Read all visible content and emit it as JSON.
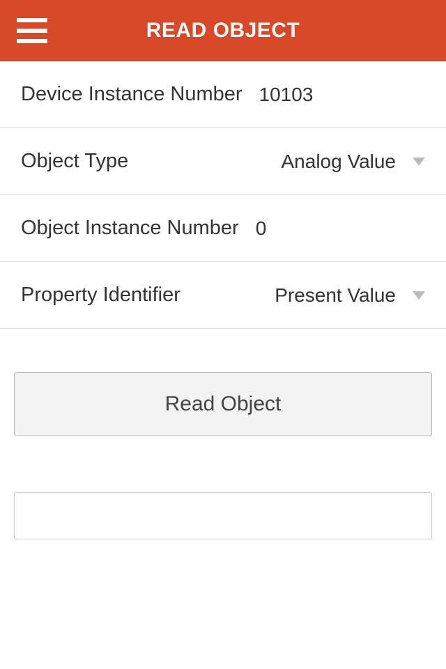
{
  "header": {
    "title": "READ OBJECT"
  },
  "form": {
    "device_instance_number": {
      "label": "Device Instance Number",
      "value": "10103"
    },
    "object_type": {
      "label": "Object Type",
      "value": "Analog Value"
    },
    "object_instance_number": {
      "label": "Object Instance Number",
      "value": "0"
    },
    "property_identifier": {
      "label": "Property Identifier",
      "value": "Present Value"
    }
  },
  "buttons": {
    "read_object": "Read Object"
  },
  "output": {
    "value": ""
  }
}
